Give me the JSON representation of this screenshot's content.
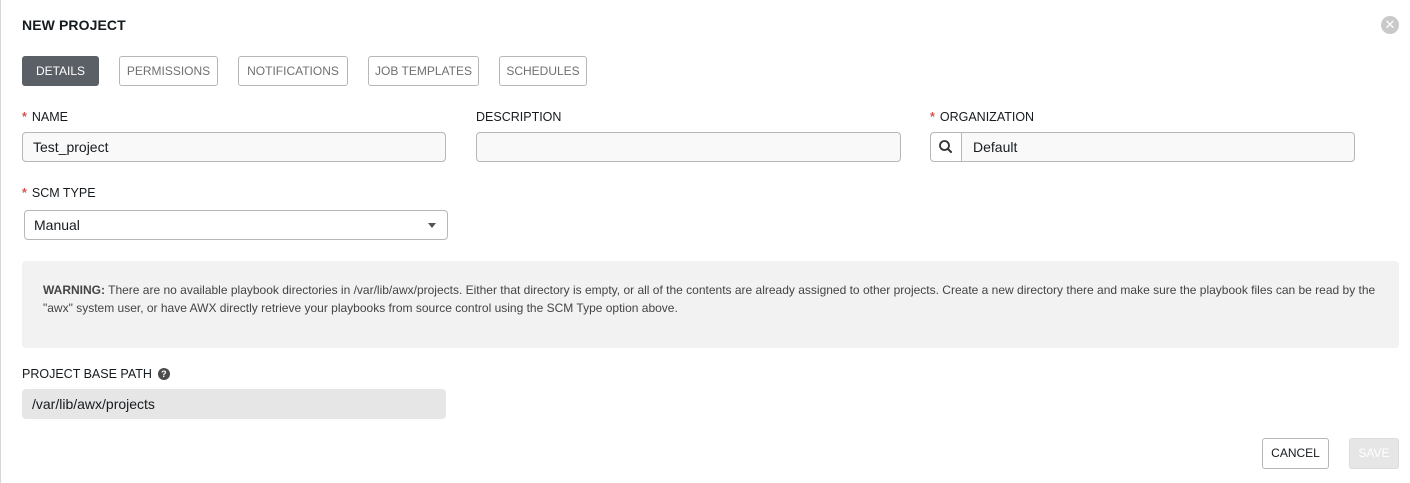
{
  "header": {
    "title": "NEW PROJECT",
    "close_icon": "close-icon"
  },
  "tabs": [
    {
      "label": "DETAILS",
      "active": true
    },
    {
      "label": "PERMISSIONS",
      "active": false
    },
    {
      "label": "NOTIFICATIONS",
      "active": false
    },
    {
      "label": "JOB TEMPLATES",
      "active": false
    },
    {
      "label": "SCHEDULES",
      "active": false
    }
  ],
  "form": {
    "required_marker": "*",
    "name": {
      "label": "NAME",
      "value": "Test_project"
    },
    "description": {
      "label": "DESCRIPTION",
      "value": ""
    },
    "organization": {
      "label": "ORGANIZATION",
      "value": "Default",
      "lookup_icon": "search-icon"
    },
    "scm_type": {
      "label": "SCM TYPE",
      "value": "Manual"
    },
    "warning": {
      "prefix": "WARNING:",
      "text": " There are no available playbook directories in /var/lib/awx/projects. Either that directory is empty, or all of the contents are already assigned to other projects. Create a new directory there and make sure the playbook files can be read by the \"awx\" system user, or have AWX directly retrieve your playbooks from source control using the SCM Type option above."
    },
    "project_base_path": {
      "label": "PROJECT BASE PATH",
      "value": "/var/lib/awx/projects",
      "help_icon": "question-circle-icon"
    }
  },
  "actions": {
    "cancel_label": "CANCEL",
    "save_label": "SAVE"
  },
  "colors": {
    "required": "#d9534f",
    "active_tab": "#5b5f66",
    "warning_bg": "#f2f2f2"
  }
}
